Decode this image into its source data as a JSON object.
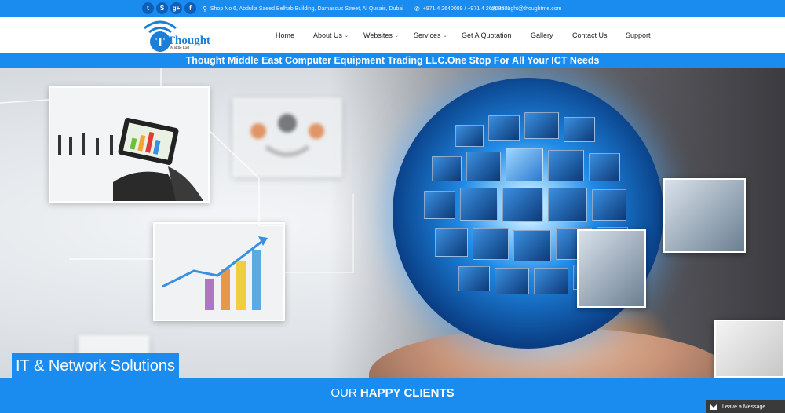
{
  "topbar": {
    "social": [
      {
        "name": "twitter-icon",
        "glyph": "t"
      },
      {
        "name": "skype-icon",
        "glyph": "S"
      },
      {
        "name": "google-plus-icon",
        "glyph": "g+"
      },
      {
        "name": "facebook-icon",
        "glyph": "f"
      }
    ],
    "address": "Shop No 6, Abdulla Saeed Belhab Building, Damascus Street, Al Qusais, Dubai",
    "phone": "+971 4 2640089 / +971 4 26708671",
    "email": "thought@thoughtme.com"
  },
  "logo": {
    "word": "Thought",
    "subtitle": "Middle East"
  },
  "nav": {
    "items": [
      {
        "label": "Home",
        "has_dropdown": false
      },
      {
        "label": "About Us",
        "has_dropdown": true
      },
      {
        "label": "Websites",
        "has_dropdown": true
      },
      {
        "label": "Services",
        "has_dropdown": true
      },
      {
        "label": "Get A Quotation",
        "has_dropdown": false
      },
      {
        "label": "Gallery",
        "has_dropdown": false
      },
      {
        "label": "Contact Us",
        "has_dropdown": false
      },
      {
        "label": "Support",
        "has_dropdown": false
      }
    ]
  },
  "tagline": "Thought Middle East Computer Equipment Trading LLC.One Stop For All Your ICT Needs",
  "hero": {
    "caption": "IT & Network Solutions"
  },
  "clients": {
    "prefix": "OUR",
    "highlight": "HAPPY CLIENTS"
  },
  "chat": {
    "label": "Leave a Message"
  },
  "colors": {
    "brand_blue": "#1a8cf0",
    "dark_chat": "#3a3a3a"
  }
}
